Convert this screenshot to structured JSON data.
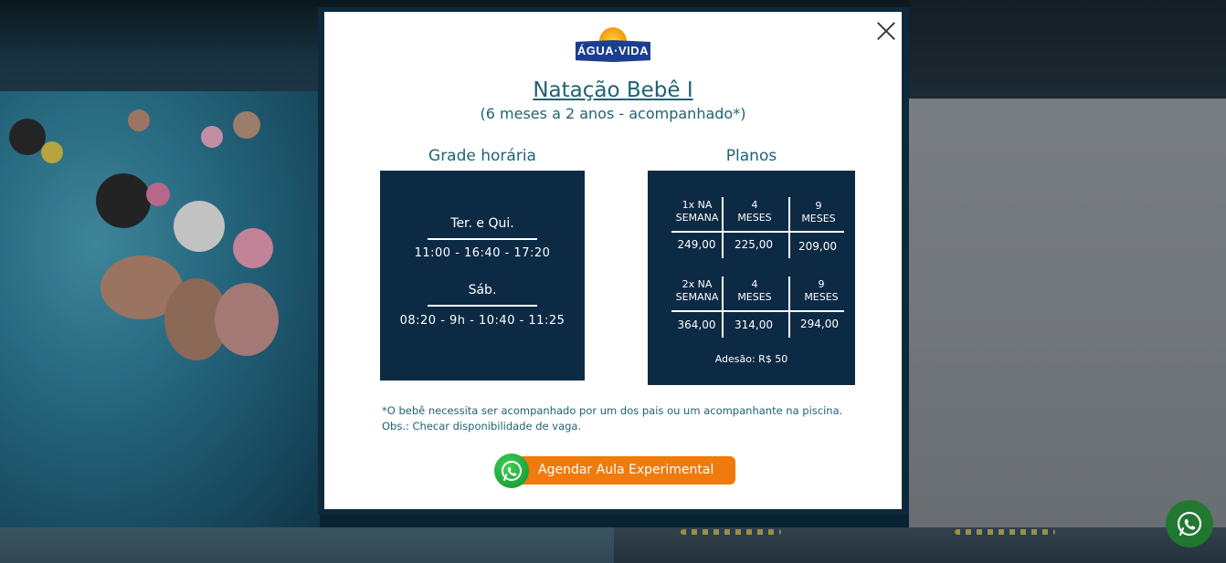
{
  "modal": {
    "logo_text": "ÁGUA·VIDA",
    "title": "Natação Bebê I",
    "subtitle": "(6 meses a 2 anos - acompanhado*)",
    "schedule": {
      "heading": "Grade horária",
      "blocks": [
        {
          "days": "Ter. e Qui.",
          "times": "11:00 - 16:40 - 17:20"
        },
        {
          "days": "Sáb.",
          "times": "08:20 - 9h - 10:40 - 11:25"
        }
      ]
    },
    "plans": {
      "heading": "Planos",
      "groups": [
        {
          "freq": [
            "1x NA",
            "SEMANA"
          ],
          "p4": [
            "4",
            "MESES"
          ],
          "p9": [
            "9",
            "MESES"
          ],
          "values": [
            "249,00",
            "225,00",
            "209,00"
          ]
        },
        {
          "freq": [
            "2x NA",
            "SEMANA"
          ],
          "p4": [
            "4",
            "MESES"
          ],
          "p9": [
            "9",
            "MESES"
          ],
          "values": [
            "364,00",
            "314,00",
            "294,00"
          ]
        }
      ],
      "adesao": "Adesão: R$ 50"
    },
    "notes": [
      "*O bebê necessita ser acompanhado por um dos pais ou um acompanhante na piscina.",
      "Obs.: Checar disponibilidade de vaga."
    ],
    "cta_label": "Agendar Aula Experimental"
  },
  "icons": {
    "close": "close-icon",
    "whatsapp": "whatsapp-icon"
  },
  "colors": {
    "accent_teal": "#1f6274",
    "panel_navy": "#0c2a44",
    "cta_orange": "#f07a0b",
    "whatsapp_green": "#22a93b"
  }
}
